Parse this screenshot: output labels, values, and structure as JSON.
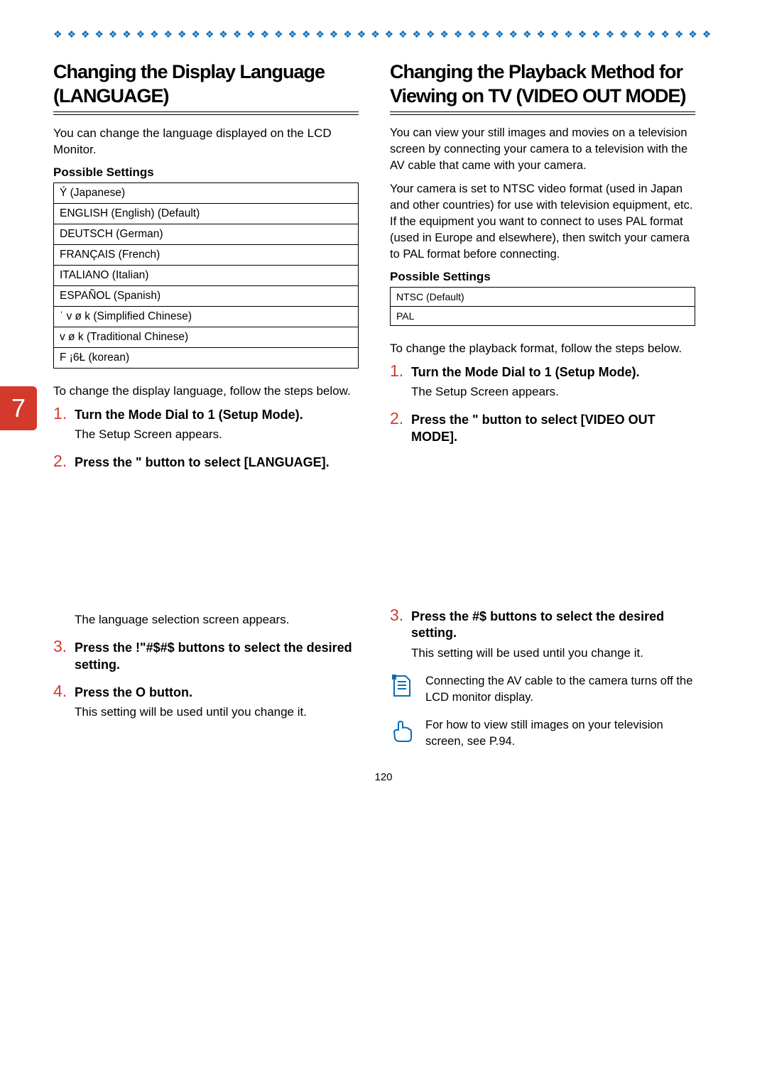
{
  "page_number": "120",
  "tab_number": "7",
  "diamonds": "❖ ❖ ❖ ❖ ❖ ❖ ❖ ❖ ❖ ❖ ❖ ❖ ❖ ❖ ❖ ❖ ❖ ❖ ❖ ❖ ❖ ❖ ❖ ❖ ❖ ❖ ❖ ❖ ❖ ❖ ❖ ❖ ❖ ❖ ❖ ❖ ❖ ❖ ❖ ❖ ❖ ❖ ❖ ❖ ❖ ❖ ❖ ❖ ❖ ❖ ❖ ❖ ❖",
  "left": {
    "title": "Changing the Display Language (LANGUAGE)",
    "intro": "You can change the language displayed on the LCD Monitor.",
    "possible_settings_label": "Possible Settings",
    "settings": [
      "Ý        (Japanese)",
      "ENGLISH (English) (Default)",
      "DEUTSCH (German)",
      "FRANÇAIS (French)",
      "ITALIANO (Italian)",
      "ESPAÑOL  (Spanish)",
      "ˈ v ø k     (Simplified Chinese)",
      " v ø k     (Traditional Chinese)",
      "F  ¡6Ł  (korean)"
    ],
    "lead": "To change the display language, follow the steps below.",
    "steps": [
      {
        "title": "Turn the Mode Dial to 1 (Setup Mode).",
        "body": "The Setup Screen appears."
      },
      {
        "title": "Press the \"   button to select [LANGUAGE].",
        "body": "The language selection screen appears."
      },
      {
        "title": "Press the !\"#$#$   buttons to select the desired setting.",
        "body": ""
      },
      {
        "title": "Press the O   button.",
        "body": "This setting will be used until you change it."
      }
    ]
  },
  "right": {
    "title": "Changing the Playback Method for Viewing on TV (VIDEO OUT MODE)",
    "intro1": "You can view your still images and movies on a television screen by connecting your camera to a television with the AV cable that came with your camera.",
    "intro2": "Your camera is set to NTSC video format (used in Japan and other countries) for use with television equipment, etc. If the equipment you want to connect to uses PAL format (used in Europe and elsewhere), then switch your camera to PAL format before connecting.",
    "possible_settings_label": "Possible Settings",
    "settings": [
      "NTSC (Default)",
      "PAL"
    ],
    "lead": "To change the playback format, follow the steps below.",
    "steps": [
      {
        "title": "Turn the Mode Dial to 1 (Setup Mode).",
        "body": "The Setup Screen appears."
      },
      {
        "title": "Press the \"   button to select [VIDEO OUT MODE].",
        "body": ""
      },
      {
        "title": "Press the #$   buttons to select the desired setting.",
        "body": "This setting will be used until you change it."
      }
    ],
    "note1": "Connecting the AV cable to the camera turns off the LCD monitor display.",
    "note2": "For how to view still images on your television screen, see P.94."
  }
}
